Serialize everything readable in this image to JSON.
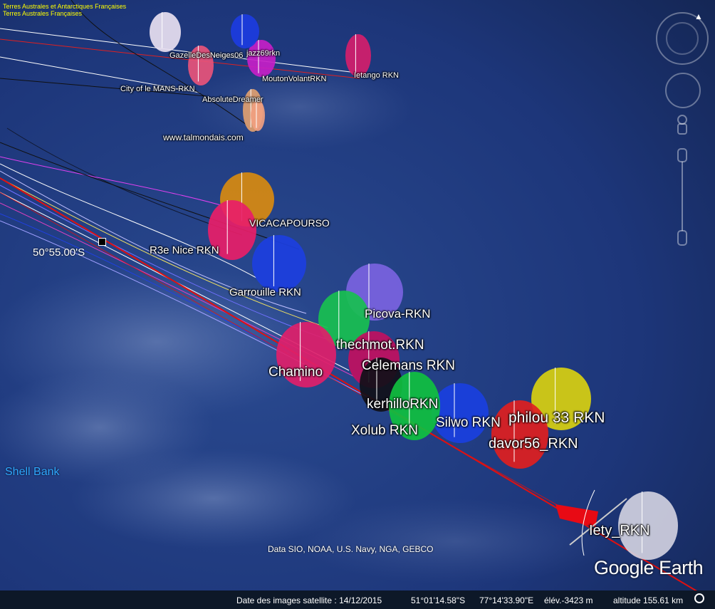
{
  "app": {
    "name": "Google Earth"
  },
  "map": {
    "credit": "Data SIO, NOAA, U.S. Navy, NGA, GEBCO",
    "logo": "Google Earth",
    "feature_label": "Shell Bank",
    "latitude_marker": "50°55.00'S",
    "tiles_layer_label_1": "Terres Australes et Antarctiques Françaises",
    "tiles_layer_label_2": "Terres Australes Françaises"
  },
  "boats": [
    {
      "label": "GazelleDesNeiges06",
      "sail_color": "#e8e0f0"
    },
    {
      "label": "jazz69rkn",
      "sail_color": "#c51fc7"
    },
    {
      "label": "MoutonVolantRKN",
      "sail_color": "#1c3ce0"
    },
    {
      "label": "Ietango RKN",
      "sail_color": "#d41e6b"
    },
    {
      "label": "City of le MANS-RKN",
      "sail_color": "#e8547a"
    },
    {
      "label": "AbsoluteDreamer",
      "sail_color": "#e0a070"
    },
    {
      "label": "www.talmondais.com",
      "sail_color": "#f0a080"
    },
    {
      "label": "VICACAPOURSO",
      "sail_color": "#d88a10"
    },
    {
      "label": "R3e Nice RKN",
      "sail_color": "#e81e68"
    },
    {
      "label": "Garrouille RKN",
      "sail_color": "#1c3fe0"
    },
    {
      "label": "Picova-RKN",
      "sail_color": "#7a63e0"
    },
    {
      "label": "thechmot.RKN",
      "sail_color": "#18c050"
    },
    {
      "label": "Celemans RKN",
      "sail_color": "#c01060"
    },
    {
      "label": "Chamino",
      "sail_color": "#e0206a"
    },
    {
      "label": "kerhilloRKN",
      "sail_color": "#101018"
    },
    {
      "label": "Silwo RKN",
      "sail_color": "#1a3fe0"
    },
    {
      "label": "philou 33 RKN",
      "sail_color": "#d8d010"
    },
    {
      "label": "Xolub RKN",
      "sail_color": "#10c040"
    },
    {
      "label": "davor56_RKN",
      "sail_color": "#e02020"
    },
    {
      "label": "Iety_RKN",
      "sail_color": "#d0d0e0"
    }
  ],
  "statusbar": {
    "imagery_date": "Date des images satellite : 14/12/2015",
    "lat": "51°01'14.58\"S",
    "lon": "77°14'33.90\"E",
    "elev": "élév.-3423 m",
    "altitude": "altitude 155.61 km"
  },
  "colors": {
    "ocean": "#1e3a78",
    "track": "#e01010",
    "feature_label": "#2fa9ff"
  }
}
